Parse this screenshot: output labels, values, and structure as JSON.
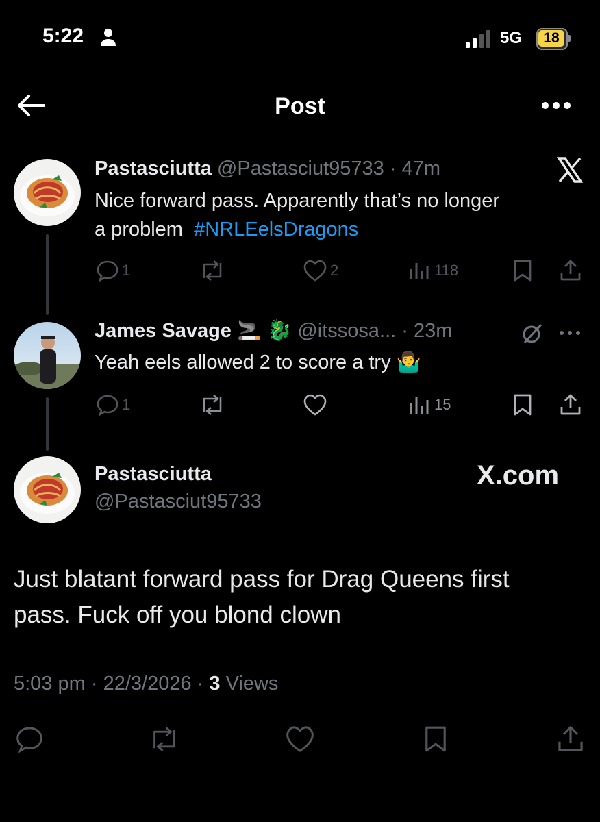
{
  "status_bar": {
    "time": "5:22",
    "network": "5G",
    "battery": "18"
  },
  "header": {
    "title": "Post"
  },
  "replies": [
    {
      "name": "Pastasciutta",
      "handle": "@Pastasciut95733",
      "time": "47m",
      "text_line1": "Nice forward pass. Apparently that’s no longer",
      "text_line2": "a problem",
      "hashtag": "#NRLEelsDragons",
      "replies": "1",
      "reposts": "",
      "likes": "2",
      "views": "118"
    },
    {
      "name": "James Savage",
      "name_emoji": "🚬 🐉",
      "handle": "@itssosa...",
      "time": "23m",
      "text": "Yeah eels allowed 2 to score a try",
      "text_emoji": "🤷‍♂️",
      "replies": "1",
      "reposts": "",
      "likes": "",
      "views": "15"
    }
  ],
  "main_post": {
    "name": "Pastasciutta",
    "handle": "@Pastasciut95733",
    "watermark": "X.com",
    "text_line1": "Just blatant forward pass for Drag Queens first",
    "text_line2": "pass. Fuck off you blond clown",
    "time": "5:03 pm",
    "date": "22/3/2026",
    "views_count": "3",
    "views_label": "Views"
  },
  "icons": {
    "back": "arrow-left-icon",
    "more": "more-horizontal-icon",
    "x_logo": "x-logo-icon",
    "grok": "grok-icon",
    "reply": "reply-icon",
    "repost": "repost-icon",
    "like": "heart-icon",
    "views": "views-icon",
    "bookmark": "bookmark-icon",
    "share": "share-icon"
  },
  "colors": {
    "background": "#000000",
    "text": "#e7e9ea",
    "secondary": "#71767b",
    "link": "#1d9bf0",
    "battery": "#f5d547"
  }
}
